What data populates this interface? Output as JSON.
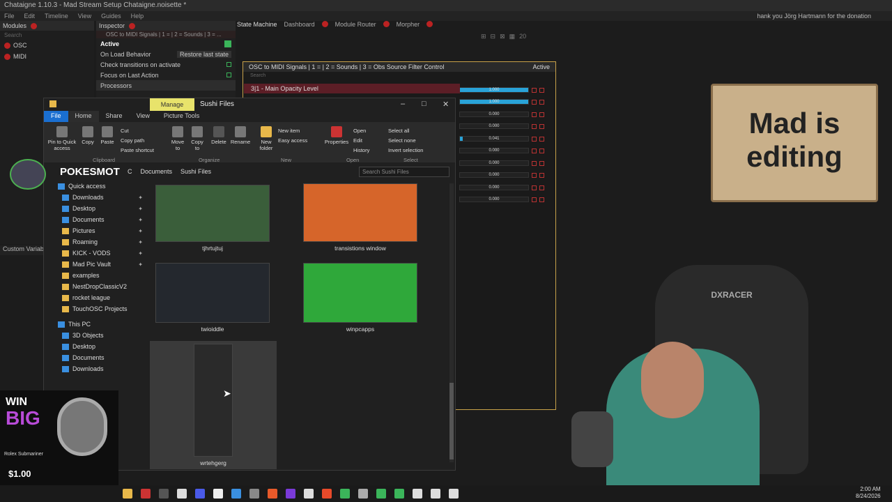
{
  "window": {
    "title": "Chataigne 1.10.3 - Mad Stream Setup Chataigne.noisette *"
  },
  "menu": [
    "File",
    "Edit",
    "Timeline",
    "View",
    "Guides",
    "Help"
  ],
  "top_right_notice": "hank you Jörg Hartmann for the donation",
  "modules": {
    "title": "Modules",
    "items": [
      {
        "label": "OSC"
      },
      {
        "label": "MIDI"
      }
    ],
    "search_placeholder": "Search"
  },
  "inspector": {
    "title": "Inspector",
    "module_label": "OSC to MIDI Signals | 1 = | 2 = Sounds | 3 = ...",
    "active": "Active",
    "on_load": "On Load Behavior",
    "on_load_value": "Restore last state",
    "check_transitions": "Check transitions on activate",
    "focus_last": "Focus on Last Action",
    "processors": "Processors"
  },
  "tabs": [
    "State Machine",
    "Dashboard",
    "Module Router",
    "Morpher"
  ],
  "toolbar_zoom": "20",
  "osc_panel": {
    "title": "OSC to MIDI Signals | 1 = | 2 = Sounds | 3 = Obs Source Filter Control",
    "active": "Active",
    "search": "Search",
    "main_param": "3|1 - Main Opacity Level",
    "values": [
      "1.000",
      "1.000",
      "0.000",
      "0.000",
      "0.041",
      "0.000",
      "0.000",
      "0.000",
      "0.000",
      "0.000"
    ]
  },
  "explorer": {
    "manage_tab": "Manage",
    "title": "Sushi Files",
    "ribbon_tabs": [
      "File",
      "Home",
      "Share",
      "View",
      "Picture Tools"
    ],
    "ribbon": {
      "pin": "Pin to Quick access",
      "copy": "Copy",
      "paste": "Paste",
      "cut": "Cut",
      "copy_path": "Copy path",
      "paste_shortcut": "Paste shortcut",
      "move_to": "Move to",
      "copy_to": "Copy to",
      "delete": "Delete",
      "rename": "Rename",
      "new_folder": "New folder",
      "new_item": "New item",
      "easy_access": "Easy access",
      "properties": "Properties",
      "open": "Open",
      "edit": "Edit",
      "history": "History",
      "select_all": "Select all",
      "select_none": "Select none",
      "invert": "Invert selection",
      "groups": [
        "Clipboard",
        "Organize",
        "New",
        "Open",
        "Select"
      ]
    },
    "address": [
      "C",
      "Documents",
      "Sushi Files"
    ],
    "search_placeholder": "Search Sushi Files",
    "nav": {
      "quick_access": "Quick access",
      "quick_items": [
        "Downloads",
        "Desktop",
        "Documents",
        "Pictures",
        "Roaming",
        "KICK - VODS",
        "Mad Pic Vault",
        "examples",
        "NestDropClassicV2",
        "rocket league",
        "TouchOSC Projects"
      ],
      "this_pc": "This PC",
      "pc_items": [
        "3D Objects",
        "Desktop",
        "Documents",
        "Downloads"
      ]
    },
    "files": [
      "tjhrtujtuj",
      "transistions window",
      "twioiddle",
      "winpcapps",
      "wrtehgerg"
    ]
  },
  "overlays": {
    "pokes_name": "POKESMOT",
    "sign": "Mad is editing",
    "chair_brand": "DXRACER",
    "ad_win": "WIN",
    "ad_big": "BIG",
    "ad_name": "Rolex Submariner",
    "ad_price": "$1.00"
  },
  "custom_variables": "Custom Variabl",
  "clock": {
    "time": "2:00 AM",
    "date": "8/24/2026"
  },
  "colors": {
    "accent": "#29a3d8",
    "manage": "#e8e36b",
    "file_tab": "#1a6fd1",
    "sign": "#c9b08a"
  }
}
